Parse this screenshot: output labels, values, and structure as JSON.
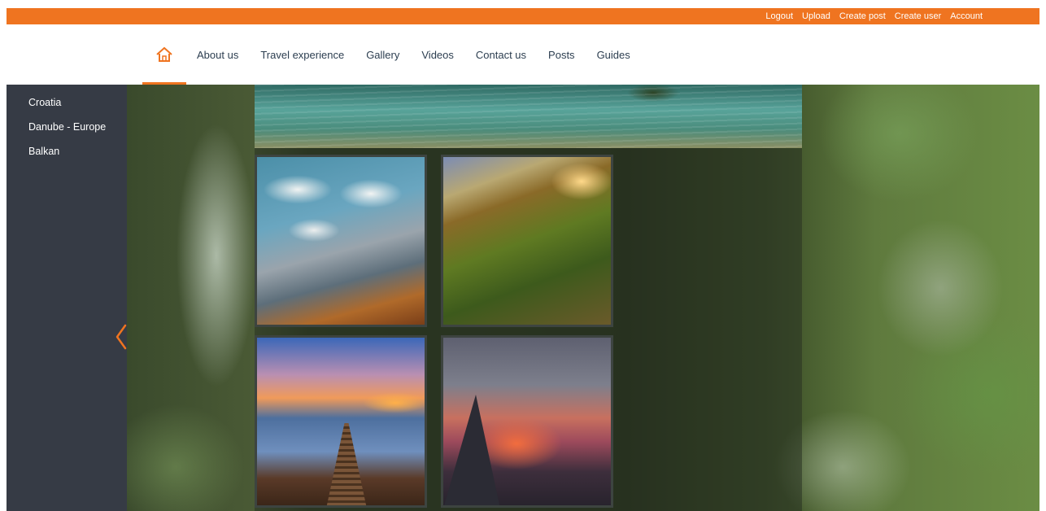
{
  "topbar": {
    "links": [
      "Logout",
      "Upload",
      "Create post",
      "Create user",
      "Account"
    ]
  },
  "nav": {
    "home_icon": "home-icon",
    "items": [
      "About us",
      "Travel experience",
      "Gallery",
      "Videos",
      "Contact us",
      "Posts",
      "Guides"
    ]
  },
  "sidebar": {
    "items": [
      "Croatia",
      "Danube - Europe",
      "Balkan"
    ]
  },
  "carousel": {
    "prev_icon": "chevron-left-icon"
  },
  "colors": {
    "accent": "#ef7420",
    "sidebar_bg": "#363b45",
    "nav_text": "#2c3e50"
  }
}
